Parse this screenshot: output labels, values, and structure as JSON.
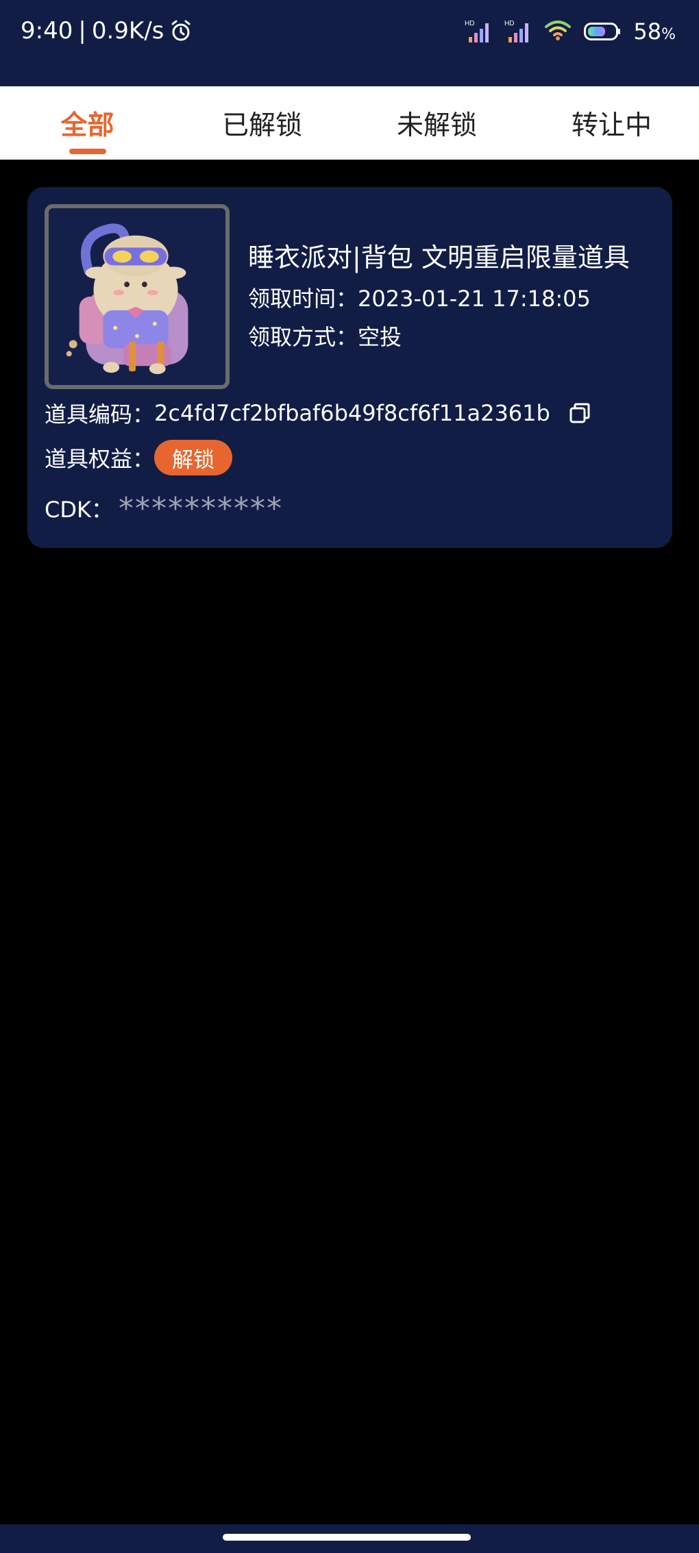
{
  "status_bar": {
    "time": "9:40",
    "separator": "|",
    "net_speed": "0.9K/s",
    "signal1_label": "HD",
    "signal2_label": "HD",
    "battery_percent": "58",
    "battery_unit": "%",
    "icons": [
      "alarm-icon",
      "signal-icon",
      "signal-icon",
      "wifi-icon",
      "battery-icon"
    ]
  },
  "tabs": [
    {
      "label": "全部",
      "active": true
    },
    {
      "label": "已解锁",
      "active": false
    },
    {
      "label": "未解锁",
      "active": false
    },
    {
      "label": "转让中",
      "active": false
    }
  ],
  "item": {
    "title": "睡衣派对|背包 文明重启限量道具",
    "claim_time_label": "领取时间：",
    "claim_time": "2023-01-21 17:18:05",
    "claim_method_label": "领取方式：",
    "claim_method": "空投",
    "code_label": "道具编码：",
    "code": "2c4fd7cf2bfbaf6b49f8cf6f11a2361b",
    "benefit_label": "道具权益：",
    "unlock_label": "解锁",
    "cdk_label": "CDK：",
    "cdk_value": "**********"
  },
  "colors": {
    "accent": "#e7662f",
    "card_bg": "#111d45",
    "tab_bg": "#ffffff",
    "page_bg": "#000000"
  }
}
